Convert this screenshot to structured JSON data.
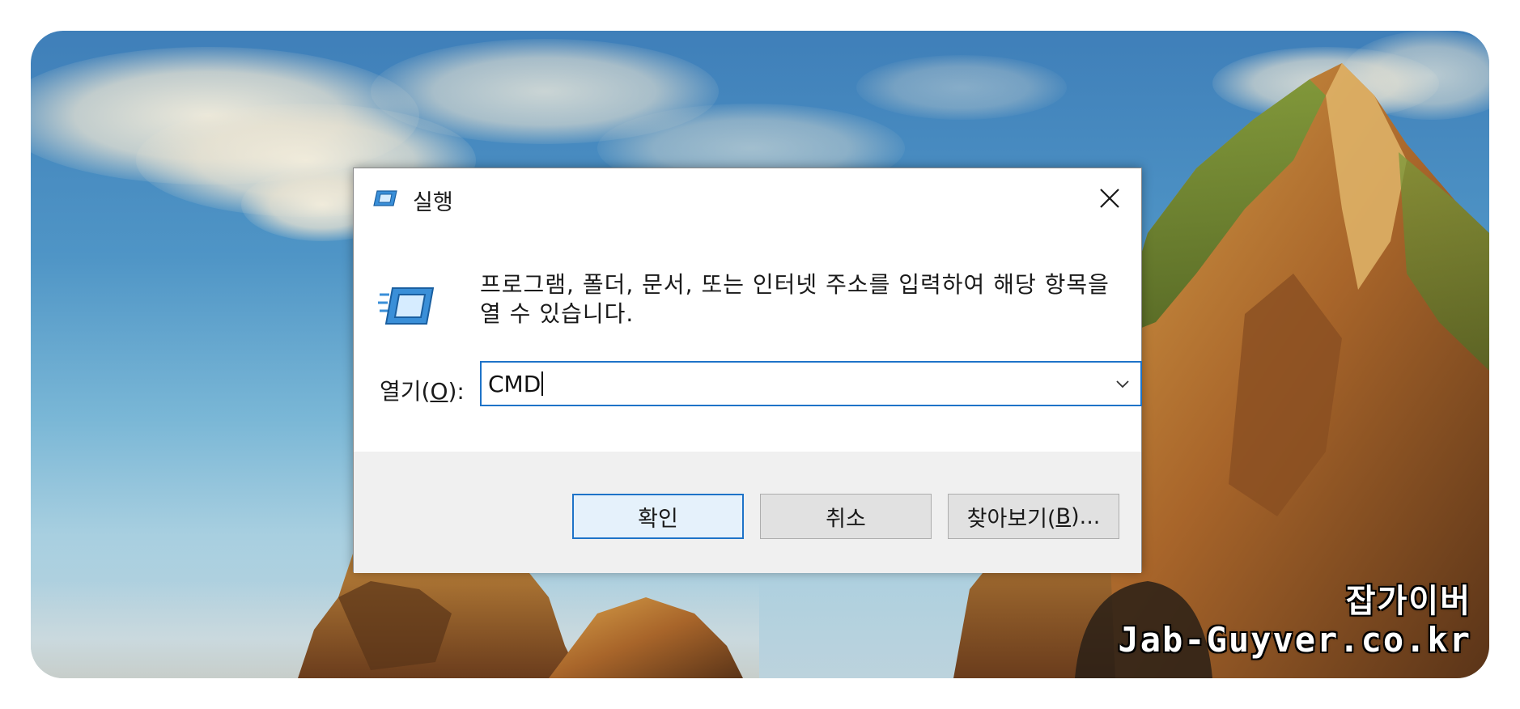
{
  "dialog": {
    "title": "실행",
    "description": "프로그램, 폴더, 문서, 또는 인터넷 주소를 입력하여 해당 항목을 열 수 있습니다.",
    "open_label_prefix": "열기(",
    "open_label_mnemonic": "O",
    "open_label_suffix": "):",
    "open_value": "CMD",
    "buttons": {
      "ok": "확인",
      "cancel": "취소",
      "browse_prefix": "찾아보기(",
      "browse_mnemonic": "B",
      "browse_suffix": ")..."
    },
    "icons": {
      "title": "run-icon",
      "large": "run-icon",
      "close": "close-icon",
      "dropdown": "chevron-down-icon"
    },
    "colors": {
      "focus_border": "#1e73c8",
      "footer_bg": "#f0f0f0",
      "button_bg": "#e1e1e1"
    }
  },
  "watermark": {
    "line1": "잡가이버",
    "line2": "Jab-Guyver.co.kr"
  }
}
